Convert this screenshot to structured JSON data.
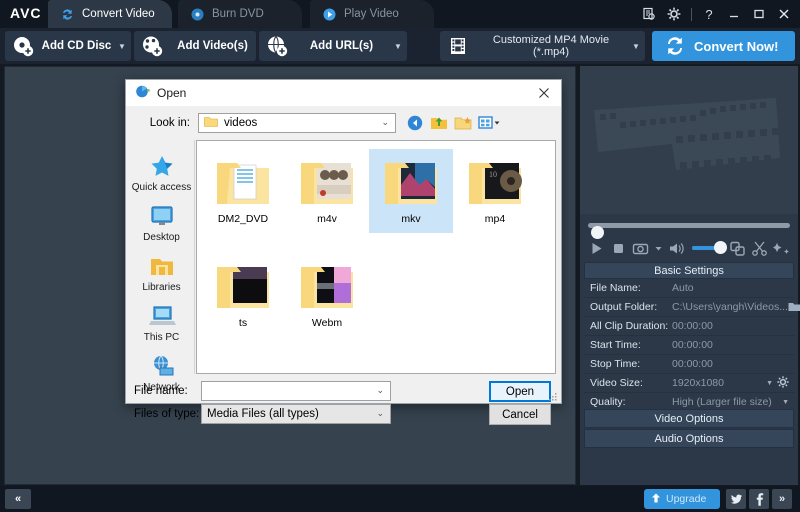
{
  "app": {
    "logo": "AVC"
  },
  "tabs": [
    {
      "label": "Convert Video",
      "icon": "convert-icon",
      "active": true
    },
    {
      "label": "Burn DVD",
      "icon": "disc-icon",
      "active": false
    },
    {
      "label": "Play Video",
      "icon": "play-icon",
      "active": false
    }
  ],
  "window_controls": [
    {
      "name": "task-list-icon",
      "glyph": "☷"
    },
    {
      "name": "gear-icon",
      "glyph": "⚙"
    },
    {
      "name": "help-icon",
      "glyph": "?"
    },
    {
      "name": "minimize-icon",
      "glyph": "–"
    },
    {
      "name": "maximize-icon",
      "glyph": "□"
    },
    {
      "name": "close-icon",
      "glyph": "✕"
    }
  ],
  "toolbar": {
    "add_cd_disc": "Add CD Disc",
    "add_videos": "Add Video(s)",
    "add_urls": "Add URL(s)",
    "caret": "▼",
    "profile": "Customized MP4 Movie (*.mp4)",
    "convert_now": "Convert Now!",
    "accent_color": "#3194dd"
  },
  "right_panel": {
    "settings_title": "Basic Settings",
    "settings": [
      {
        "key": "File Name:",
        "value": "Auto",
        "tool": ""
      },
      {
        "key": "Output Folder:",
        "value": "C:\\Users\\yangh\\Videos...",
        "tool": "folder-icon"
      },
      {
        "key": "All Clip Duration:",
        "value": "00:00:00",
        "tool": ""
      },
      {
        "key": "Start Time:",
        "value": "00:00:00",
        "tool": ""
      },
      {
        "key": "Stop Time:",
        "value": "00:00:00",
        "tool": ""
      },
      {
        "key": "Video Size:",
        "value": "1920x1080",
        "tool": "gear-icon"
      },
      {
        "key": "Quality:",
        "value": "High (Larger file size)",
        "tool": "caret"
      }
    ],
    "video_options": "Video Options",
    "audio_options": "Audio Options",
    "player": {
      "play": "play-icon",
      "stop": "stop-icon",
      "snapshot": "camera-icon",
      "volume": "volume-icon",
      "merge": "merge-icon",
      "cut": "scissors-icon",
      "effect": "effects-icon"
    }
  },
  "statusbar": {
    "collapse": "«",
    "upgrade": "Upgrade",
    "twitter": "twitter-icon",
    "facebook": "facebook-icon",
    "more": "»"
  },
  "dialog": {
    "title": "Open",
    "close": "✕",
    "look_in_label": "Look in:",
    "look_in_value": "videos",
    "tools": [
      {
        "name": "back-icon"
      },
      {
        "name": "up-one-level-icon"
      },
      {
        "name": "new-folder-icon"
      },
      {
        "name": "views-icon"
      }
    ],
    "places": [
      {
        "label": "Quick access",
        "icon": "star-icon"
      },
      {
        "label": "Desktop",
        "icon": "monitor-icon"
      },
      {
        "label": "Libraries",
        "icon": "libraries-icon"
      },
      {
        "label": "This PC",
        "icon": "pc-icon"
      },
      {
        "label": "Network",
        "icon": "network-icon"
      }
    ],
    "files": [
      {
        "name": "DM2_DVD",
        "selected": false,
        "thumb": "none"
      },
      {
        "name": "m4v",
        "selected": false,
        "thumb": "people"
      },
      {
        "name": "mkv",
        "selected": true,
        "thumb": "landscape"
      },
      {
        "name": "mp4",
        "selected": false,
        "thumb": "dark"
      },
      {
        "name": "ts",
        "selected": false,
        "thumb": "black"
      },
      {
        "name": "Webm",
        "selected": false,
        "thumb": "sunset"
      }
    ],
    "file_name_label": "File name:",
    "file_name_value": "",
    "files_of_type_label": "Files of type:",
    "files_of_type_value": "Media Files (all types)",
    "open_button": "Open",
    "cancel_button": "Cancel",
    "caret": "⌄"
  }
}
